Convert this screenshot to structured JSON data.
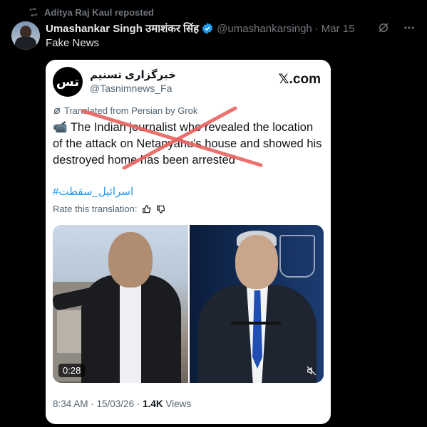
{
  "repost": {
    "label": "Aditya Raj Kaul reposted"
  },
  "post": {
    "display_name": "Umashankar Singh उमाशंकर सिंह",
    "handle": "@umashankarsingh",
    "separator": "·",
    "date": "Mar 15",
    "text": "Fake News"
  },
  "card": {
    "source_name": "خبرگزاری تسنیم",
    "source_handle": "@Tasnimnews_Fa",
    "brand": "𝕏.com",
    "logo_text": "تس",
    "translated_label": "Translated from Persian by Grok",
    "body": "📹 The Indian journalist who revealed the location of the attack on Netanyahu's house and showed his destroyed home has been arrested",
    "hashtag": "#اسرائیل_سقطت",
    "rate_label": "Rate this translation:",
    "video_time": "0:28",
    "timestamp": "8:34 AM · 15/03/26 · ",
    "views_count": "1.4K",
    "views_label": " Views"
  },
  "colors": {
    "background": "#000000",
    "accent": "#1d9bf0",
    "strike": "#e8635f"
  },
  "icons": [
    "repost-icon",
    "verified-icon",
    "grok-icon",
    "more-icon",
    "x-logo",
    "thumbs-up-icon",
    "thumbs-down-icon",
    "mute-icon"
  ]
}
